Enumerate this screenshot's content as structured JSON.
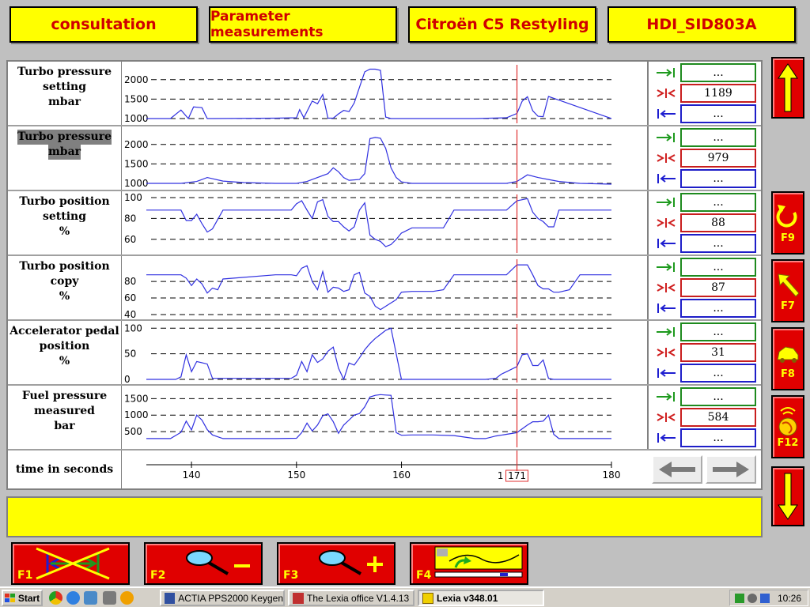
{
  "header": {
    "tabs": [
      {
        "label": "consultation"
      },
      {
        "label": "Parameter measurements"
      },
      {
        "label": "Citroën C5 Restyling"
      },
      {
        "label": "HDI_SID803A"
      }
    ]
  },
  "parameters": [
    {
      "label_lines": [
        "Turbo pressure",
        "setting",
        "mbar"
      ],
      "max_value": "...",
      "current_value": "1189",
      "min_value": "...",
      "ticks": [
        {
          "label": "2000",
          "value": 2000
        },
        {
          "label": "1500",
          "value": 1500
        },
        {
          "label": "1000",
          "value": 1000
        }
      ],
      "y_range": [
        960,
        2300
      ]
    },
    {
      "label_lines": [
        "Turbo pressure",
        "mbar"
      ],
      "selected": true,
      "max_value": "...",
      "current_value": "979",
      "min_value": "...",
      "ticks": [
        {
          "label": "2000",
          "value": 2000
        },
        {
          "label": "1500",
          "value": 1500
        },
        {
          "label": "1000",
          "value": 1000
        }
      ],
      "y_range": [
        960,
        2300
      ]
    },
    {
      "label_lines": [
        "Turbo position",
        "setting",
        "%"
      ],
      "max_value": "...",
      "current_value": "88",
      "min_value": "...",
      "ticks": [
        {
          "label": "100",
          "value": 100
        },
        {
          "label": "80",
          "value": 80
        },
        {
          "label": "60",
          "value": 60
        }
      ],
      "y_range": [
        50,
        100
      ]
    },
    {
      "label_lines": [
        "Turbo position copy",
        "%"
      ],
      "max_value": "...",
      "current_value": "87",
      "min_value": "...",
      "ticks": [
        {
          "label": "80",
          "value": 80
        },
        {
          "label": "60",
          "value": 60
        },
        {
          "label": "40",
          "value": 40
        }
      ],
      "y_range": [
        40,
        103
      ]
    },
    {
      "label_lines": [
        "Accelerator pedal",
        "position",
        "%"
      ],
      "max_value": "...",
      "current_value": "31",
      "min_value": "...",
      "ticks": [
        {
          "label": "100",
          "value": 100
        },
        {
          "label": "50",
          "value": 50
        },
        {
          "label": "0",
          "value": 0
        }
      ],
      "y_range": [
        0,
        102
      ]
    },
    {
      "label_lines": [
        "Fuel pressure",
        "measured",
        "bar"
      ],
      "max_value": "...",
      "current_value": "584",
      "min_value": "...",
      "ticks": [
        {
          "label": "1500",
          "value": 1500
        },
        {
          "label": "1000",
          "value": 1000
        },
        {
          "label": "500",
          "value": 500
        }
      ],
      "y_range": [
        120,
        1700
      ]
    }
  ],
  "time_axis": {
    "label": "time in seconds",
    "x_range": [
      135.7,
      180
    ],
    "ticks": [
      {
        "label": "140",
        "value": 140
      },
      {
        "label": "150",
        "value": 150
      },
      {
        "label": "160",
        "value": 160
      },
      {
        "label": "180",
        "value": 180
      }
    ],
    "cursor": {
      "value": 171,
      "label": "171",
      "prefix": "1"
    }
  },
  "chart_data": [
    {
      "type": "line",
      "ylabel": "Turbo pressure setting mbar",
      "x": [
        135.7,
        138,
        139,
        139.7,
        140.2,
        141,
        141.5,
        142,
        148,
        150,
        150.3,
        150.7,
        151.5,
        152,
        152.5,
        153,
        153.5,
        154,
        154.5,
        155,
        155.5,
        156,
        156.5,
        157,
        157.5,
        158,
        158.5,
        159,
        159.5,
        160,
        165,
        167,
        170,
        171,
        171.5,
        172,
        172.5,
        173,
        173.5,
        174,
        180
      ],
      "values": [
        1000,
        1000,
        1220,
        1000,
        1300,
        1280,
        1000,
        1000,
        1010,
        1020,
        1230,
        1020,
        1450,
        1380,
        1620,
        1010,
        1010,
        1120,
        1210,
        1180,
        1400,
        1800,
        2200,
        2270,
        2270,
        2240,
        1040,
        1000,
        1000,
        1000,
        1000,
        1000,
        1020,
        1130,
        1450,
        1560,
        1200,
        1060,
        1050,
        1570,
        1000
      ]
    },
    {
      "type": "line",
      "ylabel": "Turbo pressure mbar",
      "x": [
        135.7,
        139,
        140.5,
        141.5,
        143,
        145,
        148,
        150,
        151,
        152,
        153,
        153.5,
        154,
        154.5,
        155,
        156,
        156.5,
        157,
        157.5,
        158,
        158.5,
        159,
        159.5,
        160,
        161,
        162,
        165,
        168,
        170,
        171,
        172,
        173,
        174,
        175,
        177,
        180
      ],
      "values": [
        1000,
        1000,
        1050,
        1150,
        1060,
        1020,
        1000,
        1000,
        1050,
        1150,
        1250,
        1400,
        1300,
        1150,
        1080,
        1100,
        1250,
        2150,
        2180,
        2160,
        1900,
        1400,
        1150,
        1040,
        1000,
        1000,
        1000,
        1000,
        1000,
        1050,
        1220,
        1150,
        1100,
        1050,
        1000,
        980
      ]
    },
    {
      "type": "line",
      "ylabel": "Turbo position setting %",
      "x": [
        135.7,
        139,
        139.5,
        140,
        140.5,
        141,
        141.5,
        142,
        143,
        148,
        149.5,
        150,
        150.5,
        151,
        151.5,
        152,
        152.5,
        153,
        153.5,
        154,
        154.5,
        155,
        155.5,
        156,
        156.5,
        157,
        157.5,
        158,
        158.5,
        159,
        159.5,
        160,
        161,
        162,
        163,
        164,
        165,
        168,
        170,
        171,
        172,
        172.5,
        173,
        173.5,
        174,
        174.5,
        175,
        176,
        177,
        178,
        180
      ],
      "values": [
        88,
        88,
        78,
        78,
        84,
        75,
        67,
        70,
        88,
        88,
        88,
        94,
        97,
        88,
        80,
        96,
        98,
        82,
        77,
        77,
        72,
        68,
        72,
        88,
        95,
        64,
        60,
        58,
        53,
        55,
        60,
        66,
        71,
        71,
        71,
        71,
        88,
        88,
        88,
        97,
        99,
        86,
        80,
        77,
        72,
        72,
        88,
        88,
        88,
        88,
        88
      ]
    },
    {
      "type": "line",
      "ylabel": "Turbo position copy %",
      "x": [
        135.7,
        139,
        139.5,
        140,
        140.5,
        141,
        141.5,
        142,
        142.5,
        143,
        148,
        149.5,
        150,
        150.5,
        151,
        151.5,
        152,
        152.5,
        153,
        153.5,
        154,
        154.5,
        155,
        155.5,
        156,
        156.5,
        157,
        157.5,
        158,
        158.5,
        159,
        159.5,
        160,
        161,
        162,
        163,
        164,
        165,
        168,
        170,
        171,
        172,
        172.5,
        173,
        173.5,
        174,
        174.5,
        175,
        176,
        177,
        178,
        180
      ],
      "values": [
        88,
        88,
        84,
        75,
        83,
        77,
        66,
        72,
        70,
        83,
        88,
        88,
        87,
        96,
        99,
        80,
        70,
        92,
        67,
        73,
        72,
        68,
        70,
        88,
        91,
        66,
        62,
        50,
        46,
        50,
        54,
        58,
        67,
        68,
        68,
        68,
        70,
        88,
        88,
        88,
        100,
        100,
        88,
        75,
        71,
        71,
        67,
        67,
        70,
        88,
        88,
        88
      ]
    },
    {
      "type": "line",
      "ylabel": "Accelerator pedal position %",
      "x": [
        135.7,
        138.5,
        139,
        139.5,
        140,
        140.5,
        141.5,
        142,
        148,
        149.5,
        150,
        150.5,
        151,
        151.5,
        152,
        152.5,
        153,
        153.5,
        154,
        154.5,
        155,
        155.5,
        156,
        156.5,
        157,
        157.5,
        158,
        158.5,
        159,
        160,
        168,
        169,
        169.5,
        170,
        171,
        171.5,
        172,
        172.5,
        173,
        173.5,
        174,
        174.5,
        175,
        180
      ],
      "values": [
        0,
        0,
        5,
        48,
        15,
        35,
        30,
        2,
        2,
        2,
        8,
        35,
        15,
        48,
        33,
        40,
        55,
        63,
        22,
        0,
        32,
        28,
        42,
        58,
        70,
        80,
        88,
        96,
        100,
        0,
        0,
        2,
        10,
        15,
        25,
        48,
        50,
        27,
        27,
        38,
        2,
        0,
        0,
        0
      ]
    },
    {
      "type": "line",
      "ylabel": "Fuel pressure measured bar",
      "x": [
        135.7,
        138,
        139,
        139.5,
        140,
        140.5,
        141,
        141.5,
        142,
        143,
        148,
        150,
        150.5,
        151,
        151.5,
        152,
        152.5,
        153,
        153.5,
        154,
        154.5,
        155,
        155.5,
        156,
        156.5,
        157,
        157.5,
        158,
        158.5,
        159,
        159.5,
        160,
        161,
        163,
        165,
        167,
        168,
        169,
        170,
        171,
        172,
        172.5,
        173,
        173.5,
        174,
        174.5,
        175,
        177,
        180
      ],
      "values": [
        290,
        290,
        480,
        820,
        550,
        1000,
        850,
        560,
        400,
        290,
        290,
        300,
        470,
        760,
        520,
        700,
        980,
        1040,
        800,
        450,
        700,
        850,
        1000,
        1050,
        1250,
        1550,
        1600,
        1620,
        1610,
        1600,
        470,
        390,
        400,
        400,
        380,
        290,
        290,
        370,
        420,
        470,
        700,
        800,
        800,
        820,
        1000,
        420,
        290,
        290,
        290
      ]
    }
  ],
  "time_nav": {
    "prev_icon": "arrow-left-icon",
    "next_icon": "arrow-right-icon"
  },
  "side_buttons": [
    {
      "name": "scroll-up",
      "icon": "arrow-up-icon",
      "key": ""
    },
    {
      "name": "refresh",
      "icon": "rotate-icon",
      "key": "F9"
    },
    {
      "name": "pointer",
      "icon": "pointer-arrow-icon",
      "key": "F7"
    },
    {
      "name": "vehicle",
      "icon": "vehicle-icon",
      "key": "F8"
    },
    {
      "name": "globe",
      "icon": "globe-icon",
      "key": "F12"
    },
    {
      "name": "scroll-down",
      "icon": "arrow-down-icon",
      "key": ""
    }
  ],
  "function_buttons": [
    {
      "key": "F1",
      "icon": "cancel-cursors-icon"
    },
    {
      "key": "F2",
      "icon": "zoom-out-icon"
    },
    {
      "key": "F3",
      "icon": "zoom-in-icon"
    },
    {
      "key": "F4",
      "icon": "graph-overview-icon"
    }
  ],
  "taskbar": {
    "start_label": "Start",
    "tasks": [
      {
        "label": "ACTIA PPS2000 Keygen",
        "active": false
      },
      {
        "label": "The Lexia office V1.4.13",
        "active": false
      },
      {
        "label": "Lexia v348.01",
        "active": true
      }
    ],
    "clock": "10:26"
  },
  "colors": {
    "header_bg": "#ffff00",
    "header_text": "#d00000",
    "trace": "#3030e0",
    "cursor": "#e03030",
    "max_border": "#1e8a1e",
    "current_border": "#c81e1e",
    "min_border": "#1e1ec8"
  }
}
